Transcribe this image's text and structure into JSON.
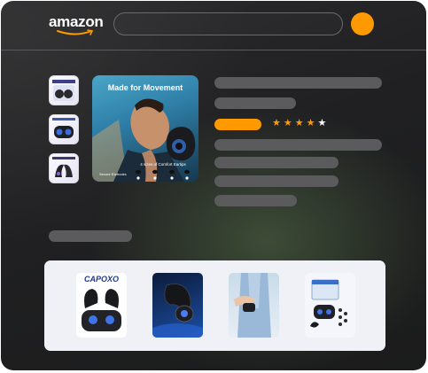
{
  "header": {
    "logo_text": "amazon",
    "search_placeholder": "",
    "accent_color": "#ff9900"
  },
  "product": {
    "main_image": {
      "title": "Made for Movement",
      "caption": "4 sizes of Comfort Eartips",
      "side_caption": "Secure Earhooks"
    },
    "thumbnails": [
      {
        "icon": "earbuds-box-thumbnail"
      },
      {
        "icon": "earbuds-case-thumbnail"
      },
      {
        "icon": "earbuds-feature-thumbnail"
      }
    ],
    "rating": {
      "value": 4,
      "max": 5
    },
    "price_color": "#ff9900"
  },
  "recommendations": {
    "items": [
      {
        "brand_text": "CAPOXO",
        "icon": "earbuds-with-case-image"
      },
      {
        "icon": "black-earbud-image"
      },
      {
        "icon": "person-holding-case-image"
      },
      {
        "icon": "earbuds-package-image"
      }
    ]
  }
}
